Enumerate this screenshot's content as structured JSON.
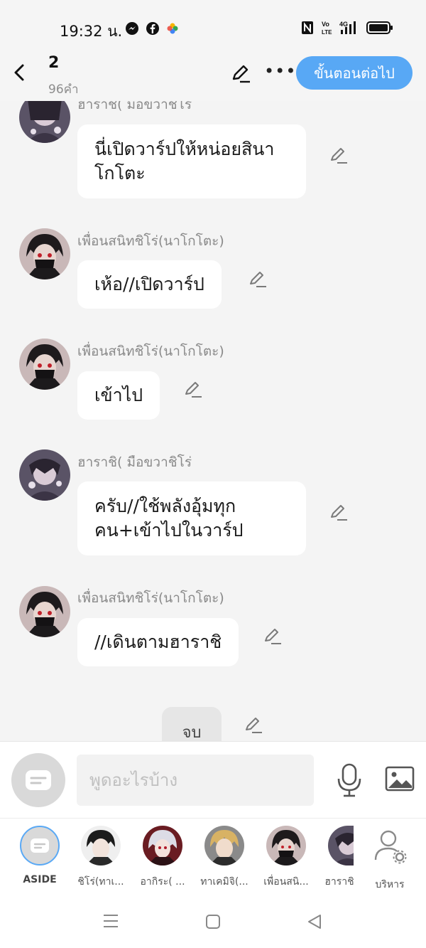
{
  "status": {
    "time": "19:32 น.",
    "network": "4G"
  },
  "header": {
    "title": "2",
    "word_count": "96คำ",
    "next_label": "ขั้นตอนต่อไป"
  },
  "messages": [
    {
      "sender": "ฮาราชิ( มือขวาชิโร่",
      "line1": "นี่เปิดวาร์ปให้หน่อยสินา",
      "line2": "โกโตะ"
    },
    {
      "sender": "เพื่อนสนิทชิโร่(นาโกโตะ)",
      "line1": "เห้อ//เปิดวาร์ป"
    },
    {
      "sender": "เพื่อนสนิทชิโร่(นาโกโตะ)",
      "line1": "เข้าไป"
    },
    {
      "sender": "ฮาราชิ( มือขวาชิโร่",
      "line1": "ครับ//ใช้พลังอุ้มทุก",
      "line2": "คนเข้าไปในวาร์ป",
      "line2_full": "คน+เข้าไปในวาร์ป"
    },
    {
      "sender": "เพื่อนสนิทชิโร่(นาโกโตะ)",
      "line1": "//เดินตามฮาราชิ"
    },
    {
      "sender": "",
      "line1": "จบ"
    }
  ],
  "compose": {
    "placeholder": "พูดอะไรบ้าง"
  },
  "characters": [
    {
      "label": "ASIDE"
    },
    {
      "label": "ชิโร่(ทาเ..."
    },
    {
      "label": "อากิระ( ..."
    },
    {
      "label": "ทาเคมิจิ(..."
    },
    {
      "label": "เพื่อนสนิ..."
    },
    {
      "label": "ฮาราชิ"
    },
    {
      "label": "บริหาร"
    }
  ],
  "colors": {
    "accent": "#58a8f5",
    "chat_bg": "#f4f4f4",
    "bubble": "#ffffff"
  }
}
